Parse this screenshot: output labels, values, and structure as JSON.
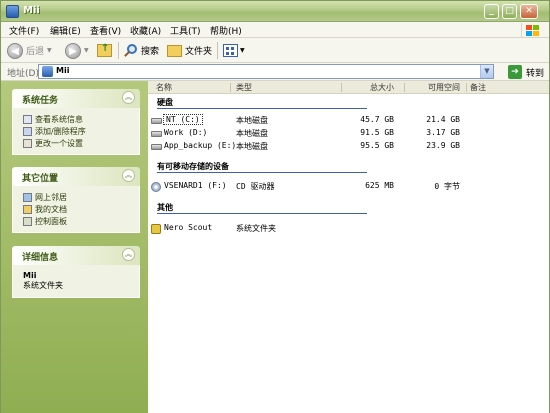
{
  "window": {
    "title": "Mii"
  },
  "menu": [
    "文件(F)",
    "编辑(E)",
    "查看(V)",
    "收藏(A)",
    "工具(T)",
    "帮助(H)"
  ],
  "toolbar": {
    "back_label": "后退",
    "search_label": "搜索",
    "folders_label": "文件夹"
  },
  "address": {
    "label": "地址(D)",
    "value": "Mii",
    "go_label": "转到"
  },
  "left": {
    "system_tasks": {
      "title": "系统任务",
      "items": [
        "查看系统信息",
        "添加/删除程序",
        "更改一个设置"
      ]
    },
    "other_places": {
      "title": "其它位置",
      "items": [
        "网上邻居",
        "我的文档",
        "控制面板"
      ]
    },
    "details": {
      "title": "详细信息",
      "name": "Mii",
      "type": "系统文件夹"
    }
  },
  "columns": {
    "name": "名称",
    "type": "类型",
    "total": "总大小",
    "free": "可用空间",
    "note": "备注"
  },
  "groups": {
    "hard_disks": "硬盘",
    "removable": "有可移动存储的设备",
    "other": "其他"
  },
  "drives": [
    {
      "name": "NT (C:)",
      "type": "本地磁盘",
      "total": "45.7 GB",
      "free": "21.4 GB"
    },
    {
      "name": "Work (D:)",
      "type": "本地磁盘",
      "total": "91.5 GB",
      "free": "3.17 GB"
    },
    {
      "name": "App_backup (E:)",
      "type": "本地磁盘",
      "total": "95.5 GB",
      "free": "23.9 GB"
    }
  ],
  "removable": [
    {
      "name": "VSENARD1 (F:)",
      "type": "CD 驱动器",
      "total": "625 MB",
      "free": "0 字节"
    }
  ],
  "other": [
    {
      "name": "Nero Scout",
      "type": "系统文件夹"
    }
  ]
}
